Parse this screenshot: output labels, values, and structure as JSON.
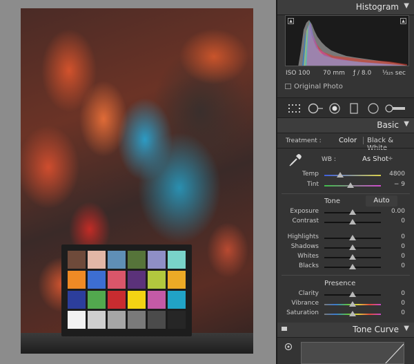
{
  "histogram": {
    "title": "Histogram",
    "iso": "ISO 100",
    "focal": "70 mm",
    "aperture": "ƒ / 8.0",
    "shutter": "¹⁄₃₂₅ sec",
    "original_photo": "Original Photo"
  },
  "basic": {
    "title": "Basic",
    "treatment_label": "Treatment :",
    "treatment_color": "Color",
    "treatment_bw": "Black & White",
    "wb_label": "WB :",
    "wb_value": "As Shot",
    "wb_arrows": "÷",
    "temp": {
      "label": "Temp",
      "value": "4800",
      "position": 0.33
    },
    "tint": {
      "label": "Tint",
      "value": "− 9",
      "position": 0.47
    },
    "tone_title": "Tone",
    "auto_label": "Auto",
    "exposure": {
      "label": "Exposure",
      "value": "0.00",
      "position": 0.5
    },
    "contrast": {
      "label": "Contrast",
      "value": "0",
      "position": 0.5
    },
    "highlights": {
      "label": "Highlights",
      "value": "0",
      "position": 0.5
    },
    "shadows": {
      "label": "Shadows",
      "value": "0",
      "position": 0.5
    },
    "whites": {
      "label": "Whites",
      "value": "0",
      "position": 0.5
    },
    "blacks": {
      "label": "Blacks",
      "value": "0",
      "position": 0.5
    },
    "presence_title": "Presence",
    "clarity": {
      "label": "Clarity",
      "value": "0",
      "position": 0.5
    },
    "vibrance": {
      "label": "Vibrance",
      "value": "0",
      "position": 0.5
    },
    "saturation": {
      "label": "Saturation",
      "value": "0",
      "position": 0.5
    }
  },
  "tone_curve": {
    "title": "Tone Curve"
  },
  "colors": {
    "panel_bg": "#343434",
    "checker_patches": [
      "#6e4a3a",
      "#e2b7a6",
      "#5f8fb6",
      "#56743a",
      "#8f8fc6",
      "#79d3c9",
      "#ef8a25",
      "#3d6ed2",
      "#d9566a",
      "#5b327a",
      "#b2c83e",
      "#ecaa26",
      "#2c3e9c",
      "#52a84e",
      "#c82c30",
      "#f2d314",
      "#c45aa6",
      "#21a3c6",
      "#f2f2f2",
      "#cfcfcf",
      "#a6a6a6",
      "#7a7a7a",
      "#4b4b4b",
      "#262626"
    ]
  }
}
